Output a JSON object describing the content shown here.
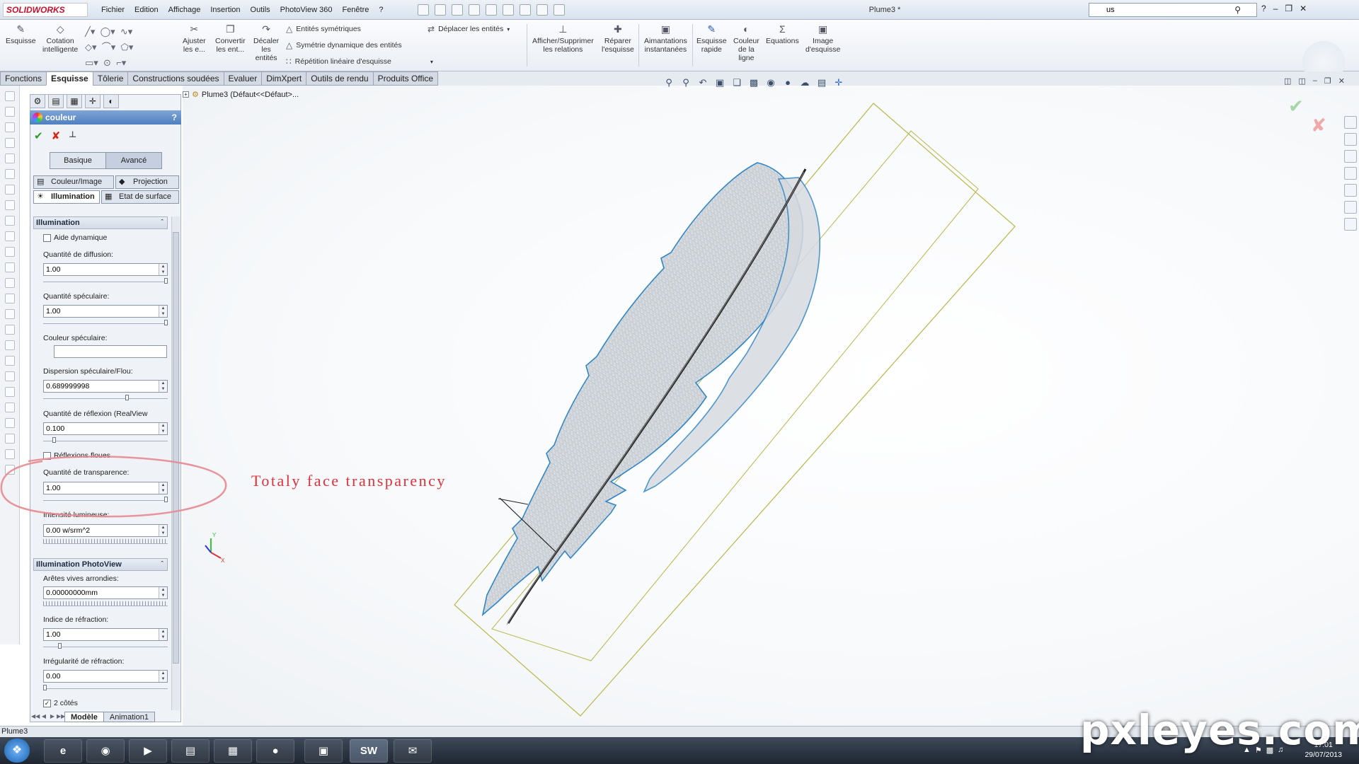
{
  "app": {
    "brand": "SOLIDWORKS",
    "document_title": "Plume3 *",
    "menus": [
      "Fichier",
      "Edition",
      "Affichage",
      "Insertion",
      "Outils",
      "PhotoView 360",
      "Fenêtre",
      "?"
    ],
    "search_value": "us"
  },
  "command_manager": {
    "esquisse": "Esquisse",
    "cotation": [
      "Cotation",
      "intelligente"
    ],
    "ajuster": [
      "Ajuster",
      "les e..."
    ],
    "convertir": [
      "Convertir",
      "les ent..."
    ],
    "decaler": [
      "Décaler",
      "les",
      "entités"
    ],
    "entites_symetriques": "Entités symétriques",
    "symetrie_dynamique": "Symétrie dynamique des entités",
    "repetition_lineaire": "Répétition linéaire d'esquisse",
    "deplacer_entites": "Déplacer les entités",
    "afficher_relations": [
      "Afficher/Supprimer",
      "les relations"
    ],
    "reparer": [
      "Réparer",
      "l'esquisse"
    ],
    "aimantations": [
      "Aimantations",
      "instantanées"
    ],
    "esquisse_rapide": [
      "Esquisse",
      "rapide"
    ],
    "couleur_ligne": [
      "Couleur",
      "de la",
      "ligne"
    ],
    "equations": "Equations",
    "image_esquisse": [
      "Image",
      "d'esquisse"
    ]
  },
  "tabs": [
    {
      "label": "Fonctions",
      "active": false
    },
    {
      "label": "Esquisse",
      "active": true
    },
    {
      "label": "Tôlerie",
      "active": false
    },
    {
      "label": "Constructions soudées",
      "active": false
    },
    {
      "label": "Evaluer",
      "active": false
    },
    {
      "label": "DimXpert",
      "active": false
    },
    {
      "label": "Outils de rendu",
      "active": false
    },
    {
      "label": "Produits Office",
      "active": false
    }
  ],
  "tree": {
    "root_label": "Plume3 (Défaut<<Défaut>..."
  },
  "property_manager": {
    "title": "couleur",
    "help": "?",
    "basic_label": "Basique",
    "advanced_label": "Avancé",
    "tab_color_image": "Couleur/Image",
    "tab_projection": "Projection",
    "tab_illumination": "Illumination",
    "tab_surface": "Etat de surface",
    "illumination_group": "Illumination",
    "dynamic_help": "Aide dynamique",
    "diffusion_label": "Quantité de diffusion:",
    "diffusion_value": "1.00",
    "specular_label": "Quantité spéculaire:",
    "specular_value": "1.00",
    "specular_color_label": "Couleur spéculaire:",
    "dispersion_label": "Dispersion spéculaire/Flou:",
    "dispersion_value": "0.689999998",
    "reflection_label": "Quantité de réflexion (RealView",
    "reflection_value": "0.100",
    "blurry_reflections": "Réflexions floues",
    "transparency_label": "Quantité de transparence:",
    "transparency_value": "1.00",
    "luminous_label": "Intensité lumineuse:",
    "luminous_value": "0.00 w/srm^2",
    "photoview_group": "Illumination PhotoView",
    "rounded_edges_label": "Arêtes vives arrondies:",
    "rounded_edges_value": "0.00000000mm",
    "refraction_label": "Indice de réfraction:",
    "refraction_value": "1.00",
    "refraction_irregularity_label": "Irrégularité de réfraction:",
    "refraction_irregularity_value": "0.00",
    "two_sides": "2 côtés",
    "levels": {
      "diffusion": 1.0,
      "specular": 1.0,
      "dispersion": 0.69,
      "reflection": 0.1,
      "transparency": 1.0,
      "refraction_index": 0.15,
      "refraction_irregularity": 0.0
    }
  },
  "bottom_tabs": [
    {
      "label": "Modèle",
      "active": true
    },
    {
      "label": "Animation1",
      "active": false
    }
  ],
  "annotation": "Totaly face transparency",
  "status_bar": "Plume3",
  "taskbar": {
    "time": "17:01",
    "date": "29/07/2013"
  },
  "watermark": "pxleyes.com",
  "colors": {
    "accent_header": "#4f7fc0",
    "annotation_red": "#e0303a",
    "feather_outline": "#2f86c6",
    "bbox_line": "#b8b84a"
  }
}
